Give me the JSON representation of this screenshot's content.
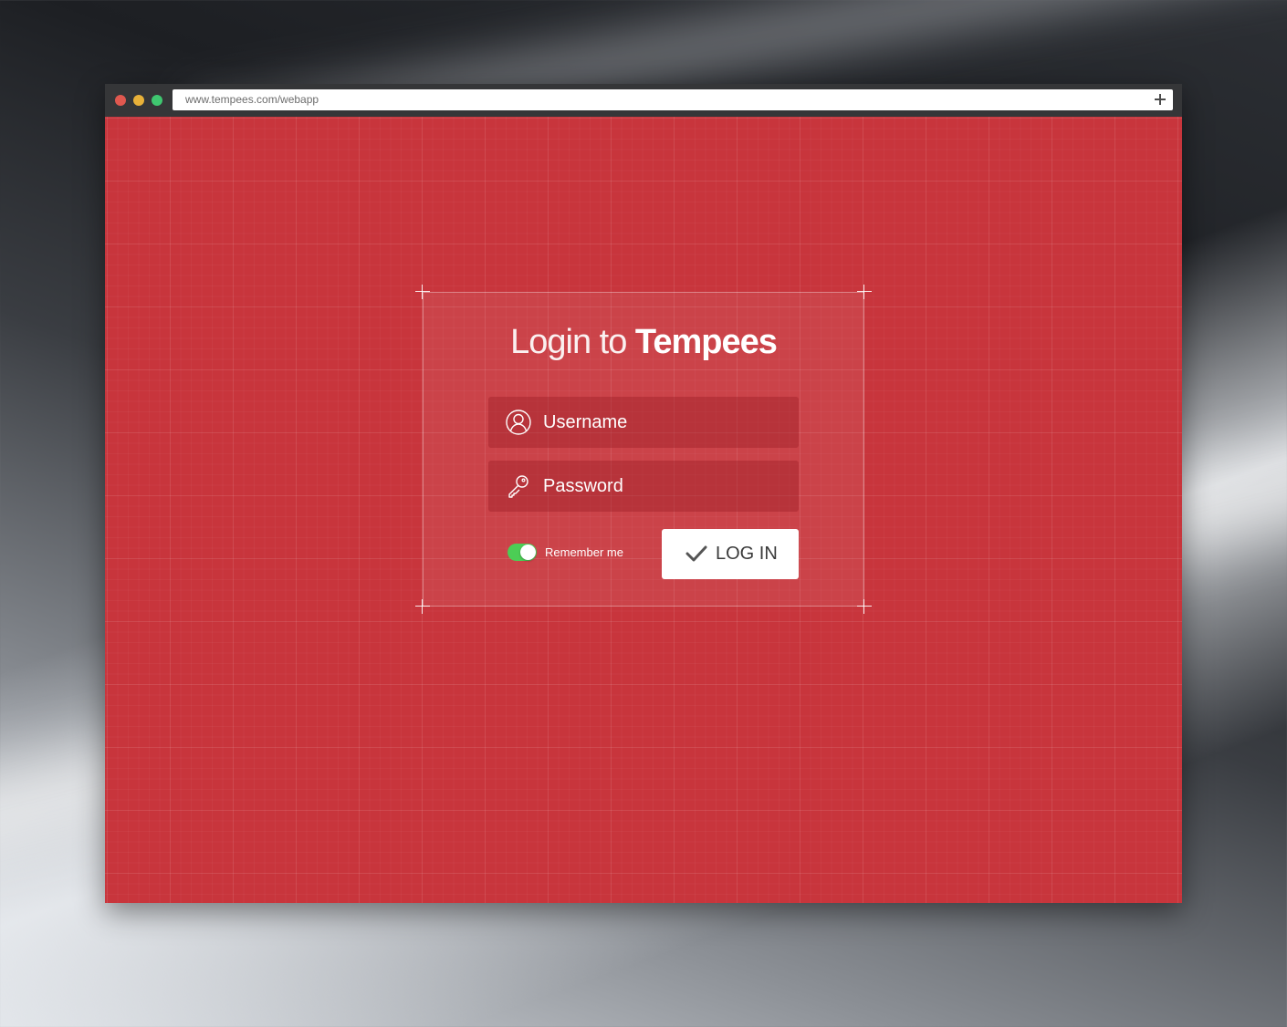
{
  "browser": {
    "url": "www.tempees.com/webapp",
    "traffic_lights": {
      "close_color": "#e0584f",
      "minimize_color": "#e8b139",
      "zoom_color": "#3fc770"
    },
    "new_tab_icon": "plus-icon"
  },
  "login": {
    "title_prefix": "Login to",
    "title_brand": "Tempees",
    "username_placeholder": "Username",
    "username_icon": "user-icon",
    "password_placeholder": "Password",
    "password_icon": "key-icon",
    "remember_label": "Remember me",
    "remember_checked": true,
    "submit_label": "LOG IN",
    "submit_icon": "checkmark-icon"
  },
  "colors": {
    "accent": "#c8353c",
    "toggle_on": "#4ccd55",
    "button_bg": "#ffffff"
  }
}
